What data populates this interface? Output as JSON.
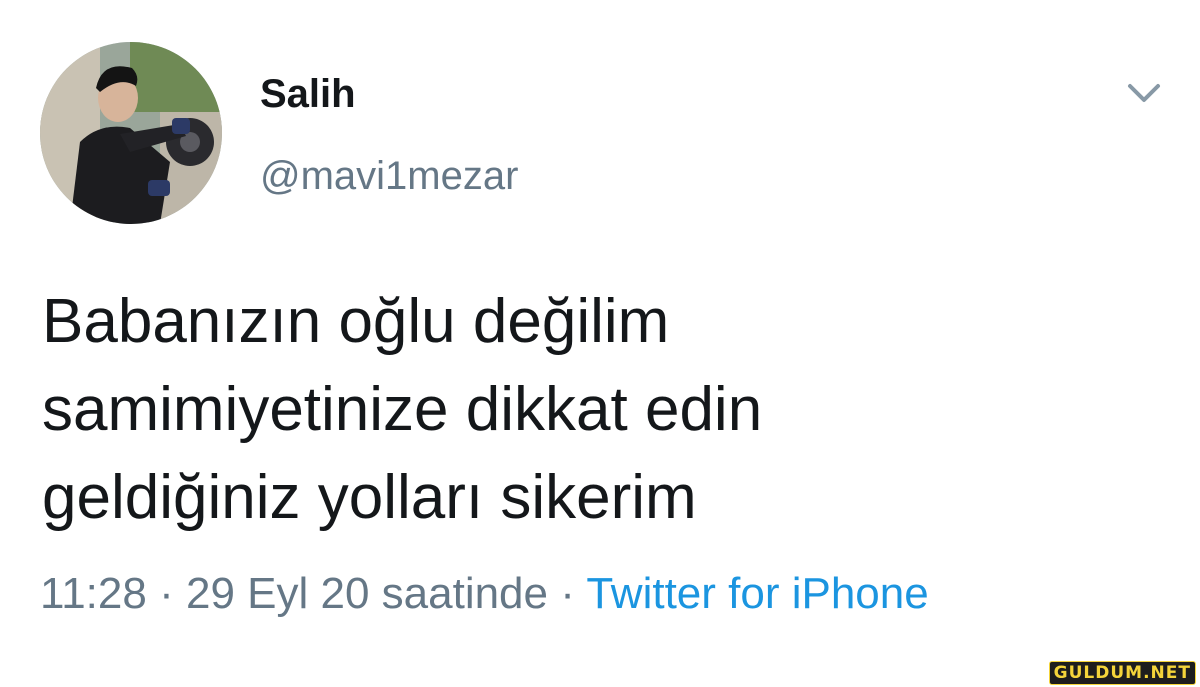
{
  "user": {
    "display_name": "Salih",
    "handle": "@mavi1mezar"
  },
  "icons": {
    "avatar": "profile-photo",
    "menu": "chevron-down-icon"
  },
  "tweet": {
    "lines": [
      "Babanızın oğlu değilim",
      "samimiyetinize dikkat edin",
      "geldiğiniz yolları sikerim"
    ]
  },
  "meta": {
    "time": "11:28",
    "separator": "·",
    "date": "29 Eyl 20 saatinde",
    "source": "Twitter for iPhone"
  },
  "watermark": {
    "text": "GULDUM.NET"
  },
  "colors": {
    "text": "#14171a",
    "secondary": "#657786",
    "link": "#1b95e0",
    "background": "#ffffff"
  }
}
